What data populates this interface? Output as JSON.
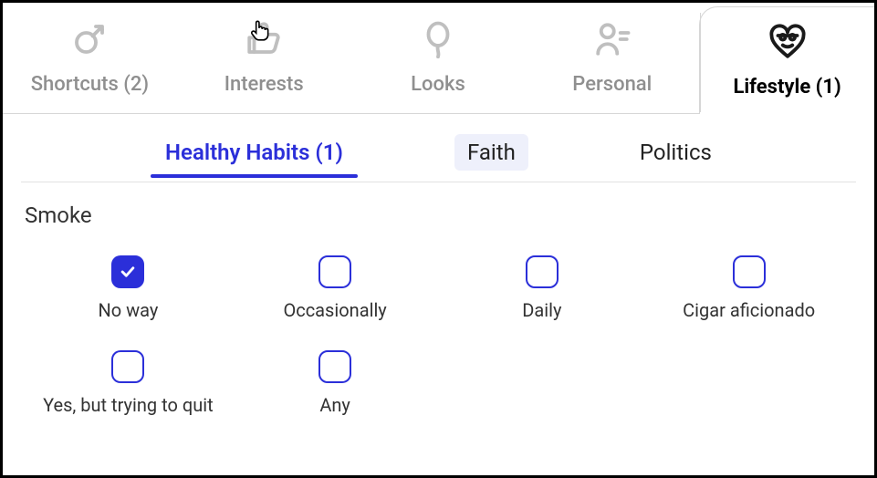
{
  "top_tabs": {
    "shortcuts": {
      "label": "Shortcuts (2)"
    },
    "interests": {
      "label": "Interests"
    },
    "looks": {
      "label": "Looks"
    },
    "personal": {
      "label": "Personal"
    },
    "lifestyle": {
      "label": "Lifestyle (1)",
      "active": true
    }
  },
  "sub_tabs": {
    "healthy_habits": {
      "label": "Healthy Habits (1)",
      "active": true
    },
    "faith": {
      "label": "Faith"
    },
    "politics": {
      "label": "Politics"
    }
  },
  "section": {
    "title": "Smoke",
    "options": [
      {
        "label": "No way",
        "checked": true
      },
      {
        "label": "Occasionally",
        "checked": false
      },
      {
        "label": "Daily",
        "checked": false
      },
      {
        "label": "Cigar aficionado",
        "checked": false
      },
      {
        "label": "Yes, but trying to quit",
        "checked": false
      },
      {
        "label": "Any",
        "checked": false
      }
    ]
  }
}
